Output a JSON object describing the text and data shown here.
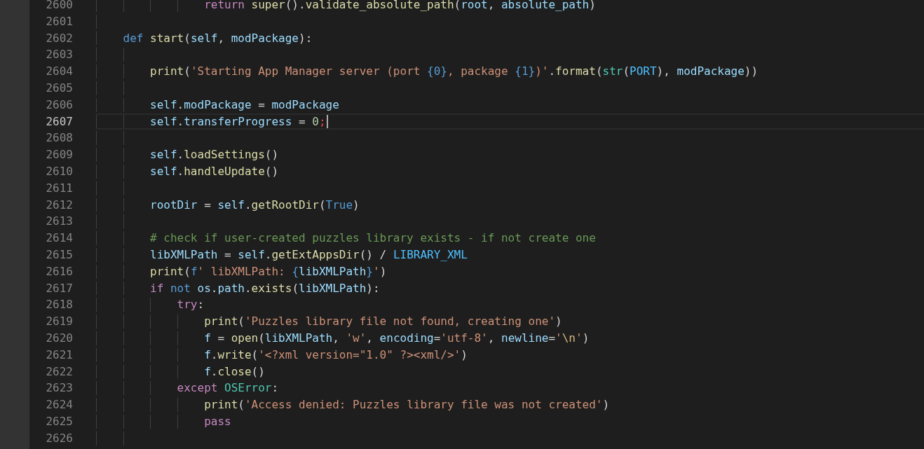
{
  "editor": {
    "lines": [
      {
        "children": [
          {
            "children": [
              {
                "children": [
                  {
                    "number": "2600",
                    "current": false,
                    "tokens": [
                      {
                        "kind": "control",
                        "text": "return"
                      },
                      {
                        "kind": "function",
                        "text": " super"
                      },
                      {
                        "kind": "plain",
                        "text": "()."
                      },
                      {
                        "kind": "function",
                        "text": "validate_absolute_path"
                      },
                      {
                        "kind": "plain",
                        "text": "("
                      },
                      {
                        "kind": "variable",
                        "text": "root"
                      },
                      {
                        "kind": "plain",
                        "text": ", "
                      },
                      {
                        "kind": "variable",
                        "text": "absolute_path"
                      },
                      {
                        "kind": "plain",
                        "text": ")"
                      }
                    ]
                  }
                ]
              }
            ]
          }
        ]
      },
      {
        "number": "2601",
        "current": false
      },
      {
        "number": "2602",
        "current": false,
        "tokens": [
          {
            "kind": "keyword",
            "text": "def"
          },
          {
            "kind": "function",
            "text": " start"
          },
          {
            "kind": "plain",
            "text": "("
          },
          {
            "kind": "variable",
            "text": "self"
          },
          {
            "kind": "plain",
            "text": ", "
          },
          {
            "kind": "variable",
            "text": "modPackage"
          },
          {
            "kind": "plain",
            "text": "):"
          }
        ],
        "children": [
          {
            "number": "2603",
            "current": false
          },
          {
            "number": "2604",
            "current": false,
            "tokens": [
              {
                "kind": "function",
                "text": "print"
              },
              {
                "kind": "plain",
                "text": "("
              },
              {
                "kind": "string",
                "text": "'Starting App Manager server (port "
              },
              {
                "kind": "keyword",
                "text": "{0}"
              },
              {
                "kind": "string",
                "text": ", package "
              },
              {
                "kind": "keyword",
                "text": "{1}"
              },
              {
                "kind": "string",
                "text": ")'"
              },
              {
                "kind": "plain",
                "text": "."
              },
              {
                "kind": "function",
                "text": "format"
              },
              {
                "kind": "plain",
                "text": "("
              },
              {
                "kind": "class",
                "text": "str"
              },
              {
                "kind": "plain",
                "text": "("
              },
              {
                "kind": "constant",
                "text": "PORT"
              },
              {
                "kind": "plain",
                "text": "), "
              },
              {
                "kind": "variable",
                "text": "modPackage"
              },
              {
                "kind": "plain",
                "text": "))"
              }
            ]
          },
          {
            "number": "2605",
            "current": false
          },
          {
            "number": "2606",
            "current": false,
            "tokens": [
              {
                "kind": "variable",
                "text": "self"
              },
              {
                "kind": "plain",
                "text": "."
              },
              {
                "kind": "variable",
                "text": "modPackage"
              },
              {
                "kind": "plain",
                "text": " = "
              },
              {
                "kind": "variable",
                "text": "modPackage"
              }
            ]
          },
          {
            "number": "2607",
            "current": true,
            "tokens": [
              {
                "kind": "variable",
                "text": "self"
              },
              {
                "kind": "plain",
                "text": "."
              },
              {
                "kind": "variable",
                "text": "transferProgress"
              },
              {
                "kind": "plain",
                "text": " = "
              },
              {
                "kind": "number",
                "text": "0"
              },
              {
                "kind": "error",
                "text": ";"
              }
            ]
          },
          {
            "number": "2608",
            "current": false
          },
          {
            "number": "2609",
            "current": false,
            "tokens": [
              {
                "kind": "variable",
                "text": "self"
              },
              {
                "kind": "plain",
                "text": "."
              },
              {
                "kind": "function",
                "text": "loadSettings"
              },
              {
                "kind": "plain",
                "text": "()"
              }
            ]
          },
          {
            "number": "2610",
            "current": false,
            "tokens": [
              {
                "kind": "variable",
                "text": "self"
              },
              {
                "kind": "plain",
                "text": "."
              },
              {
                "kind": "function",
                "text": "handleUpdate"
              },
              {
                "kind": "plain",
                "text": "()"
              }
            ]
          },
          {
            "number": "2611",
            "current": false
          },
          {
            "number": "2612",
            "current": false,
            "tokens": [
              {
                "kind": "variable",
                "text": "rootDir"
              },
              {
                "kind": "plain",
                "text": " = "
              },
              {
                "kind": "variable",
                "text": "self"
              },
              {
                "kind": "plain",
                "text": "."
              },
              {
                "kind": "function",
                "text": "getRootDir"
              },
              {
                "kind": "plain",
                "text": "("
              },
              {
                "kind": "keyword",
                "text": "True"
              },
              {
                "kind": "plain",
                "text": ")"
              }
            ]
          },
          {
            "number": "2613",
            "current": false
          },
          {
            "number": "2614",
            "current": false,
            "tokens": [
              {
                "kind": "comment",
                "text": "# check if user-created puzzles library exists - if not create one"
              }
            ]
          },
          {
            "number": "2615",
            "current": false,
            "tokens": [
              {
                "kind": "variable",
                "text": "libXMLPath"
              },
              {
                "kind": "plain",
                "text": " = "
              },
              {
                "kind": "variable",
                "text": "self"
              },
              {
                "kind": "plain",
                "text": "."
              },
              {
                "kind": "function",
                "text": "getExtAppsDir"
              },
              {
                "kind": "plain",
                "text": "() / "
              },
              {
                "kind": "constant",
                "text": "LIBRARY_XML"
              }
            ]
          },
          {
            "number": "2616",
            "current": false,
            "tokens": [
              {
                "kind": "function",
                "text": "print"
              },
              {
                "kind": "plain",
                "text": "("
              },
              {
                "kind": "keyword",
                "text": "f"
              },
              {
                "kind": "string",
                "text": "' libXMLPath: "
              },
              {
                "kind": "keyword",
                "text": "{"
              },
              {
                "kind": "variable",
                "text": "libXMLPath"
              },
              {
                "kind": "keyword",
                "text": "}"
              },
              {
                "kind": "string",
                "text": "'"
              },
              {
                "kind": "plain",
                "text": ")"
              }
            ]
          },
          {
            "number": "2617",
            "current": false,
            "tokens": [
              {
                "kind": "control",
                "text": "if"
              },
              {
                "kind": "keyword",
                "text": " not"
              },
              {
                "kind": "variable",
                "text": " os"
              },
              {
                "kind": "plain",
                "text": "."
              },
              {
                "kind": "variable",
                "text": "path"
              },
              {
                "kind": "plain",
                "text": "."
              },
              {
                "kind": "function",
                "text": "exists"
              },
              {
                "kind": "plain",
                "text": "("
              },
              {
                "kind": "variable",
                "text": "libXMLPath"
              },
              {
                "kind": "plain",
                "text": "):"
              }
            ],
            "children": [
              {
                "number": "2618",
                "current": false,
                "tokens": [
                  {
                    "kind": "control",
                    "text": "try"
                  },
                  {
                    "kind": "plain",
                    "text": ":"
                  }
                ],
                "children": [
                  {
                    "number": "2619",
                    "current": false,
                    "tokens": [
                      {
                        "kind": "function",
                        "text": "print"
                      },
                      {
                        "kind": "plain",
                        "text": "("
                      },
                      {
                        "kind": "string",
                        "text": "'Puzzles library file not found, creating one'"
                      },
                      {
                        "kind": "plain",
                        "text": ")"
                      }
                    ]
                  },
                  {
                    "number": "2620",
                    "current": false,
                    "tokens": [
                      {
                        "kind": "variable",
                        "text": "f"
                      },
                      {
                        "kind": "plain",
                        "text": " = "
                      },
                      {
                        "kind": "function",
                        "text": "open"
                      },
                      {
                        "kind": "plain",
                        "text": "("
                      },
                      {
                        "kind": "variable",
                        "text": "libXMLPath"
                      },
                      {
                        "kind": "plain",
                        "text": ", "
                      },
                      {
                        "kind": "string",
                        "text": "'w'"
                      },
                      {
                        "kind": "plain",
                        "text": ", "
                      },
                      {
                        "kind": "variable",
                        "text": "encoding"
                      },
                      {
                        "kind": "plain",
                        "text": "="
                      },
                      {
                        "kind": "string",
                        "text": "'utf-8'"
                      },
                      {
                        "kind": "plain",
                        "text": ", "
                      },
                      {
                        "kind": "variable",
                        "text": "newline"
                      },
                      {
                        "kind": "plain",
                        "text": "="
                      },
                      {
                        "kind": "string",
                        "text": "'"
                      },
                      {
                        "kind": "escape",
                        "text": "\\n"
                      },
                      {
                        "kind": "string",
                        "text": "'"
                      },
                      {
                        "kind": "plain",
                        "text": ")"
                      }
                    ]
                  },
                  {
                    "number": "2621",
                    "current": false,
                    "tokens": [
                      {
                        "kind": "variable",
                        "text": "f"
                      },
                      {
                        "kind": "plain",
                        "text": "."
                      },
                      {
                        "kind": "function",
                        "text": "write"
                      },
                      {
                        "kind": "plain",
                        "text": "("
                      },
                      {
                        "kind": "string",
                        "text": "'<?xml version=\"1.0\" ?><xml/>'"
                      },
                      {
                        "kind": "plain",
                        "text": ")"
                      }
                    ]
                  },
                  {
                    "number": "2622",
                    "current": false,
                    "tokens": [
                      {
                        "kind": "variable",
                        "text": "f"
                      },
                      {
                        "kind": "plain",
                        "text": "."
                      },
                      {
                        "kind": "function",
                        "text": "close"
                      },
                      {
                        "kind": "plain",
                        "text": "()"
                      }
                    ]
                  }
                ]
              },
              {
                "number": "2623",
                "current": false,
                "tokens": [
                  {
                    "kind": "control",
                    "text": "except"
                  },
                  {
                    "kind": "class",
                    "text": " OSError"
                  },
                  {
                    "kind": "plain",
                    "text": ":"
                  }
                ],
                "children": [
                  {
                    "number": "2624",
                    "current": false,
                    "tokens": [
                      {
                        "kind": "function",
                        "text": "print"
                      },
                      {
                        "kind": "plain",
                        "text": "("
                      },
                      {
                        "kind": "string",
                        "text": "'Access denied: Puzzles library file was not created'"
                      },
                      {
                        "kind": "plain",
                        "text": ")"
                      }
                    ]
                  },
                  {
                    "number": "2625",
                    "current": false,
                    "tokens": [
                      {
                        "kind": "control",
                        "text": "pass"
                      }
                    ]
                  }
                ]
              }
            ]
          },
          {
            "number": "2626",
            "current": false
          }
        ]
      }
    ]
  }
}
